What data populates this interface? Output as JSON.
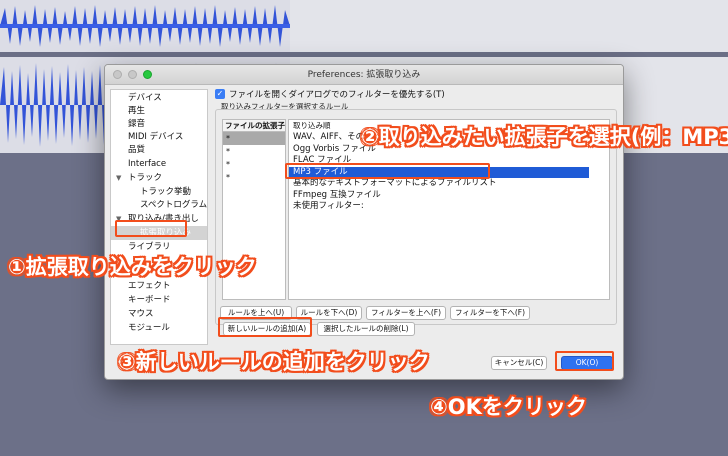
{
  "dialog": {
    "title": "Preferences: 拡張取り込み"
  },
  "sidebar": {
    "items": [
      {
        "label": "デバイス",
        "indent": 0
      },
      {
        "label": "再生",
        "indent": 0
      },
      {
        "label": "録音",
        "indent": 0
      },
      {
        "label": "MIDI デバイス",
        "indent": 0
      },
      {
        "label": "品質",
        "indent": 0
      },
      {
        "label": "Interface",
        "indent": 0
      },
      {
        "label": "トラック",
        "indent": 0,
        "caret": "▼"
      },
      {
        "label": "トラック挙動",
        "indent": 2
      },
      {
        "label": "スペクトログラム",
        "indent": 2
      },
      {
        "label": "取り込み/書き出し",
        "indent": 0,
        "caret": "▼"
      },
      {
        "label": "拡張取り込み",
        "indent": 2,
        "selected": true
      },
      {
        "label": "ライブラリ",
        "indent": 0
      },
      {
        "label": "",
        "indent": 0
      },
      {
        "label": "エフェクト",
        "indent": 0
      },
      {
        "label": "キーボード",
        "indent": 0
      },
      {
        "label": "マウス",
        "indent": 0
      },
      {
        "label": "モジュール",
        "indent": 0
      }
    ]
  },
  "filter_checkbox": {
    "label": "ファイルを開くダイアログでのフィルターを優先する(T)",
    "checked": true
  },
  "rules_group": {
    "title": "取り込みフィルターを選択するルール",
    "ext_header": "ファイルの拡張子",
    "ext_rows": [
      "*",
      "*",
      "*",
      "*"
    ],
    "rule_header": "取り込み順",
    "rule_rows": [
      "WAV、AIFF、その他",
      "Ogg Vorbis ファイル",
      "FLAC ファイル",
      "MP3 ファイル",
      "基本的なテキストフォーマットによるファイルリスト",
      "FFmpeg 互換ファイル",
      "未使用フィルター:"
    ],
    "selected_rule": 3
  },
  "buttons": {
    "rule_up": "ルールを上へ(U)",
    "rule_down": "ルールを下へ(D)",
    "filter_up": "フィルターを上へ(F)",
    "filter_down": "フィルターを下へ(F)",
    "add_rule": "新しいルールの追加(A)",
    "delete_rule": "選択したルールの削除(L)",
    "cancel": "キャンセル(C)",
    "ok": "OK(O)"
  },
  "annotations": {
    "step1": "①拡張取り込みをクリック",
    "step2": "②取り込みたい拡張子を選択(例：MP3)",
    "step3": "③新しいルールの追加をクリック",
    "step4": "④OKをクリック"
  },
  "colors": {
    "highlight": "#f24d1c",
    "selection": "#1f5bd6",
    "waveform": "#3354d8"
  }
}
